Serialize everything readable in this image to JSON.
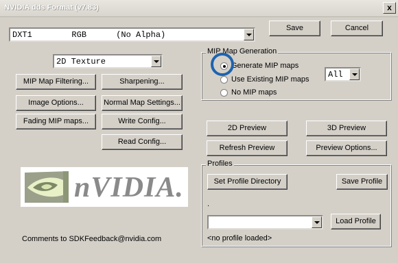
{
  "window": {
    "title": "NVIDIA dds Format (v7.83)",
    "close_label": "x"
  },
  "format_combo": {
    "value": "DXT1        RGB      (No Alpha)"
  },
  "buttons": {
    "save": "Save",
    "cancel": "Cancel",
    "mip_filtering": "MIP Map Filtering...",
    "sharpening": "Sharpening...",
    "image_options": "Image Options...",
    "normal_map": "Normal Map Settings...",
    "fading_mip": "Fading MIP maps...",
    "write_config": "Write Config...",
    "read_config": "Read Config...",
    "preview_2d": "2D Preview",
    "preview_3d": "3D Preview",
    "refresh_preview": "Refresh Preview",
    "preview_options": "Preview Options...",
    "set_profile_dir": "Set Profile Directory",
    "save_profile": "Save Profile",
    "load_profile": "Load Profile"
  },
  "texture_combo": {
    "value": "2D Texture"
  },
  "mip_group": {
    "label": "MIP Map Generation",
    "options": [
      "Generate MIP maps",
      "Use Existing MIP maps",
      "No MIP maps"
    ],
    "selected": "Generate MIP maps",
    "levels_value": "All"
  },
  "profiles": {
    "label": "Profiles",
    "dot": ".",
    "status": "<no profile loaded>",
    "profile_combo_value": ""
  },
  "logo": {
    "brand": "nVIDIA."
  },
  "footer": {
    "comments": "Comments to SDKFeedback@nvidia.com"
  }
}
